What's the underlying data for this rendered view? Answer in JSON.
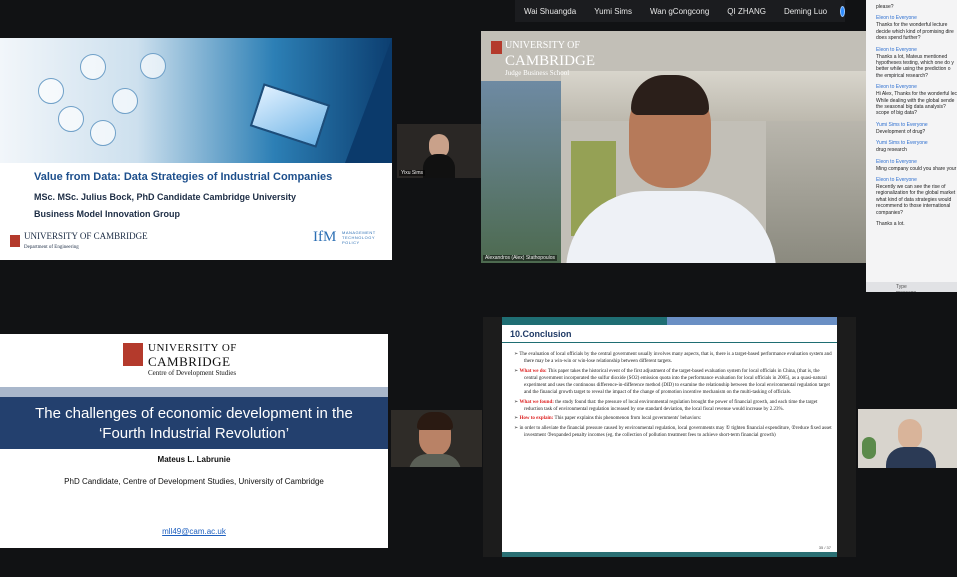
{
  "participants_bar": {
    "names": [
      "Wai Shuangda",
      "Yumi Sims",
      "Wan gCongcong",
      "QI ZHANG",
      "Deming Luo"
    ]
  },
  "slide1": {
    "title": "Value from Data: Data Strategies of Industrial Companies",
    "line1": "MSc. MSc. Julius Bock, PhD Candidate Cambridge University",
    "line2": "Business Model Innovation Group",
    "logo_name": "UNIVERSITY OF CAMBRIDGE",
    "logo_dept": "Department of Engineering",
    "ifm": "IfM",
    "ifm_text": "MANAGEMENT TECHNOLOGY POLICY"
  },
  "tile_small1": {
    "name": "Yixu Sims"
  },
  "main_video": {
    "logo_line1": "UNIVERSITY OF",
    "logo_line2": "CAMBRIDGE",
    "logo_line3": "Judge Business School",
    "name_tag": "Alexandros (Alex) Stathopoulos"
  },
  "chat": {
    "messages": [
      {
        "from": "",
        "text": "please?"
      },
      {
        "from": "Eleon to Everyone",
        "text": "Thanks for the wonderful lecture"
      },
      {
        "from": "",
        "text": "decide which kind of promising dire"
      },
      {
        "from": "",
        "text": "does spend further?"
      },
      {
        "from": "Eleon to Everyone",
        "text": "Thanks a lot, Mateus mentioned"
      },
      {
        "from": "",
        "text": "hypotheses testing, which one do y"
      },
      {
        "from": "",
        "text": "better while using the prediction o"
      },
      {
        "from": "",
        "text": "the empirical research?"
      },
      {
        "from": "Eleon to Everyone",
        "text": "Hi Alex, Thanks for the wonderful lec"
      },
      {
        "from": "",
        "text": "While dealing with the global sende"
      },
      {
        "from": "",
        "text": "the seasonal big data analysis?"
      },
      {
        "from": "",
        "text": "scope of big data?"
      },
      {
        "from": "Yumi Sims to Everyone",
        "text": "Development of drug?"
      },
      {
        "from": "Yumi Sims to Everyone",
        "text": "drug research"
      },
      {
        "from": "Eleon to Everyone",
        "text": "Ming company could you share your"
      },
      {
        "from": "Eleon to Everyone",
        "text": "Recently we can see the rise of"
      },
      {
        "from": "",
        "text": "regionalization for the global market"
      },
      {
        "from": "",
        "text": "what kind of data strategies would"
      },
      {
        "from": "",
        "text": "recommend to those international"
      },
      {
        "from": "",
        "text": "companies?"
      },
      {
        "from": "",
        "text": "Thanks a lot."
      }
    ],
    "input_placeholder": "Type message here..."
  },
  "slide2": {
    "uni_line1": "UNIVERSITY OF",
    "uni_line2": "CAMBRIDGE",
    "centre": "Centre of Development Studies",
    "title_line1": "The challenges of economic development in the",
    "title_line2": "‘Fourth Industrial Revolution’",
    "author": "Mateus L. Labrunie",
    "affiliation": "PhD Candidate, Centre of Development Studies, University of Cambridge",
    "email": "mll49@cam.ac.uk"
  },
  "slide3": {
    "heading": "10.Conclusion",
    "b1": "The evaluation of local officials by the central government usually involves many aspects, that is, there is a target-based performance evaluation system and there may be a win-win or win-lose relationship between different targets.",
    "b2_label": "What we do:",
    "b2": "This paper takes the historical event of the first adjustment of the target-based evaluation system for local officials in China, (that is, the central government incorporated the sulfur dioxide (SO2) emission quota into the performance evaluation for local officials in 2005), as a quasi-natural experiment and uses the continuous difference-in-difference method (DID) to examine the relationship between the local environmental regulation target and the financial growth target to reveal the impact of the change of promotion incentive mechanism on the multi-tasking of officials.",
    "b3_label": "What we found:",
    "b3": "the study found that: the pressure of local environmental regulation brought the power of financial growth, and each time the target reduction task of environmental regulation increased by one standard deviation, the local fiscal revenue would increase by 2.23%.",
    "b4_label": "How to explain:",
    "b4": "This paper explains this phenomenon from local governments' behaviors:",
    "b5": "in order to alleviate the financial pressure caused by environmental regulation, local governments may ① tighten financial expenditure, ②reduce fixed asset investment ③expanded penalty incomes (eg. the collection of pollution treatment fees to achieve short-term financial growth)",
    "page": "35 / 37"
  }
}
